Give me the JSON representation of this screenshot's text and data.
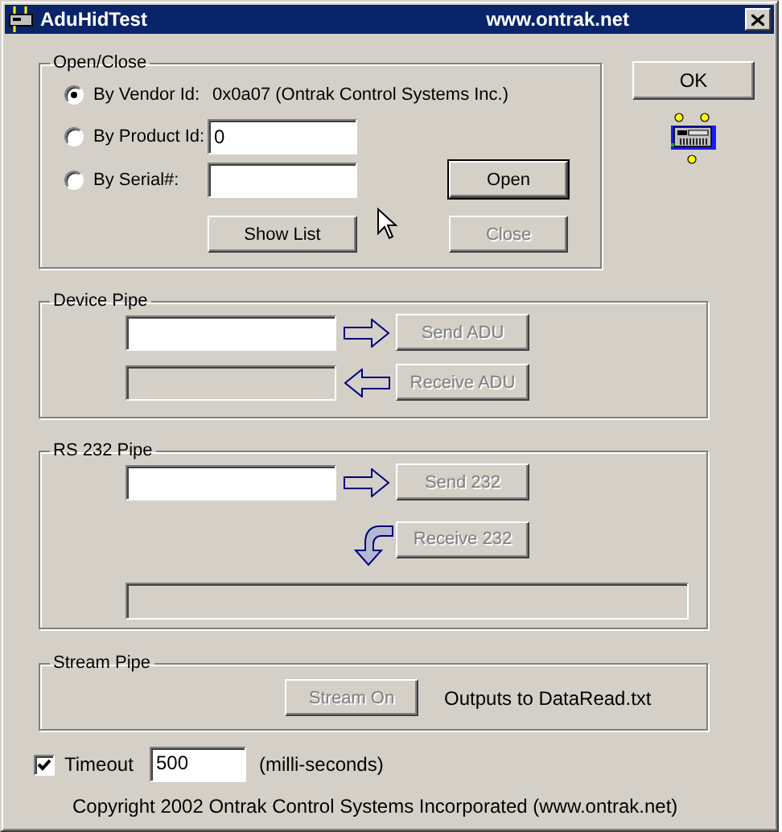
{
  "window": {
    "title": "AduHidTest",
    "subtitle": "www.ontrak.net"
  },
  "open_close": {
    "title": "Open/Close",
    "options": [
      {
        "kind": "text",
        "label": "By Vendor Id:",
        "selected": true,
        "value": "0x0a07 (Ontrak Control Systems Inc.)"
      },
      {
        "kind": "field",
        "label": "By Product Id:",
        "selected": false,
        "value": "0"
      },
      {
        "kind": "field",
        "label": "By Serial#:",
        "selected": false
      }
    ],
    "buttons": [
      {
        "label": "Open",
        "disabled": false,
        "default": true
      },
      {
        "label": "Show List",
        "disabled": false,
        "default": false
      },
      {
        "label": "Close",
        "disabled": true,
        "default": false
      }
    ]
  },
  "ok_button": {
    "label": "OK"
  },
  "device_pipe": {
    "title": "Device Pipe",
    "rows": [
      {
        "kind": "send",
        "field_disabled": false,
        "button": "Send ADU",
        "button_disabled": true
      },
      {
        "kind": "receive",
        "field_disabled": true,
        "button": "Receive ADU",
        "button_disabled": true
      }
    ]
  },
  "rs232_pipe": {
    "title": "RS 232 Pipe",
    "send": {
      "button": "Send 232",
      "disabled": true
    },
    "receive": {
      "button": "Receive 232",
      "disabled": true
    },
    "output": {
      "disabled": true
    }
  },
  "stream_pipe": {
    "title": "Stream Pipe",
    "button": {
      "label": "Stream On",
      "disabled": true
    },
    "note": "Outputs to DataRead.txt"
  },
  "timeout": {
    "label": "Timeout",
    "checked": true,
    "value": "500",
    "unit": "(milli-seconds)"
  },
  "copyright": "Copyright 2002 Ontrak Control Systems Incorporated (www.ontrak.net)"
}
